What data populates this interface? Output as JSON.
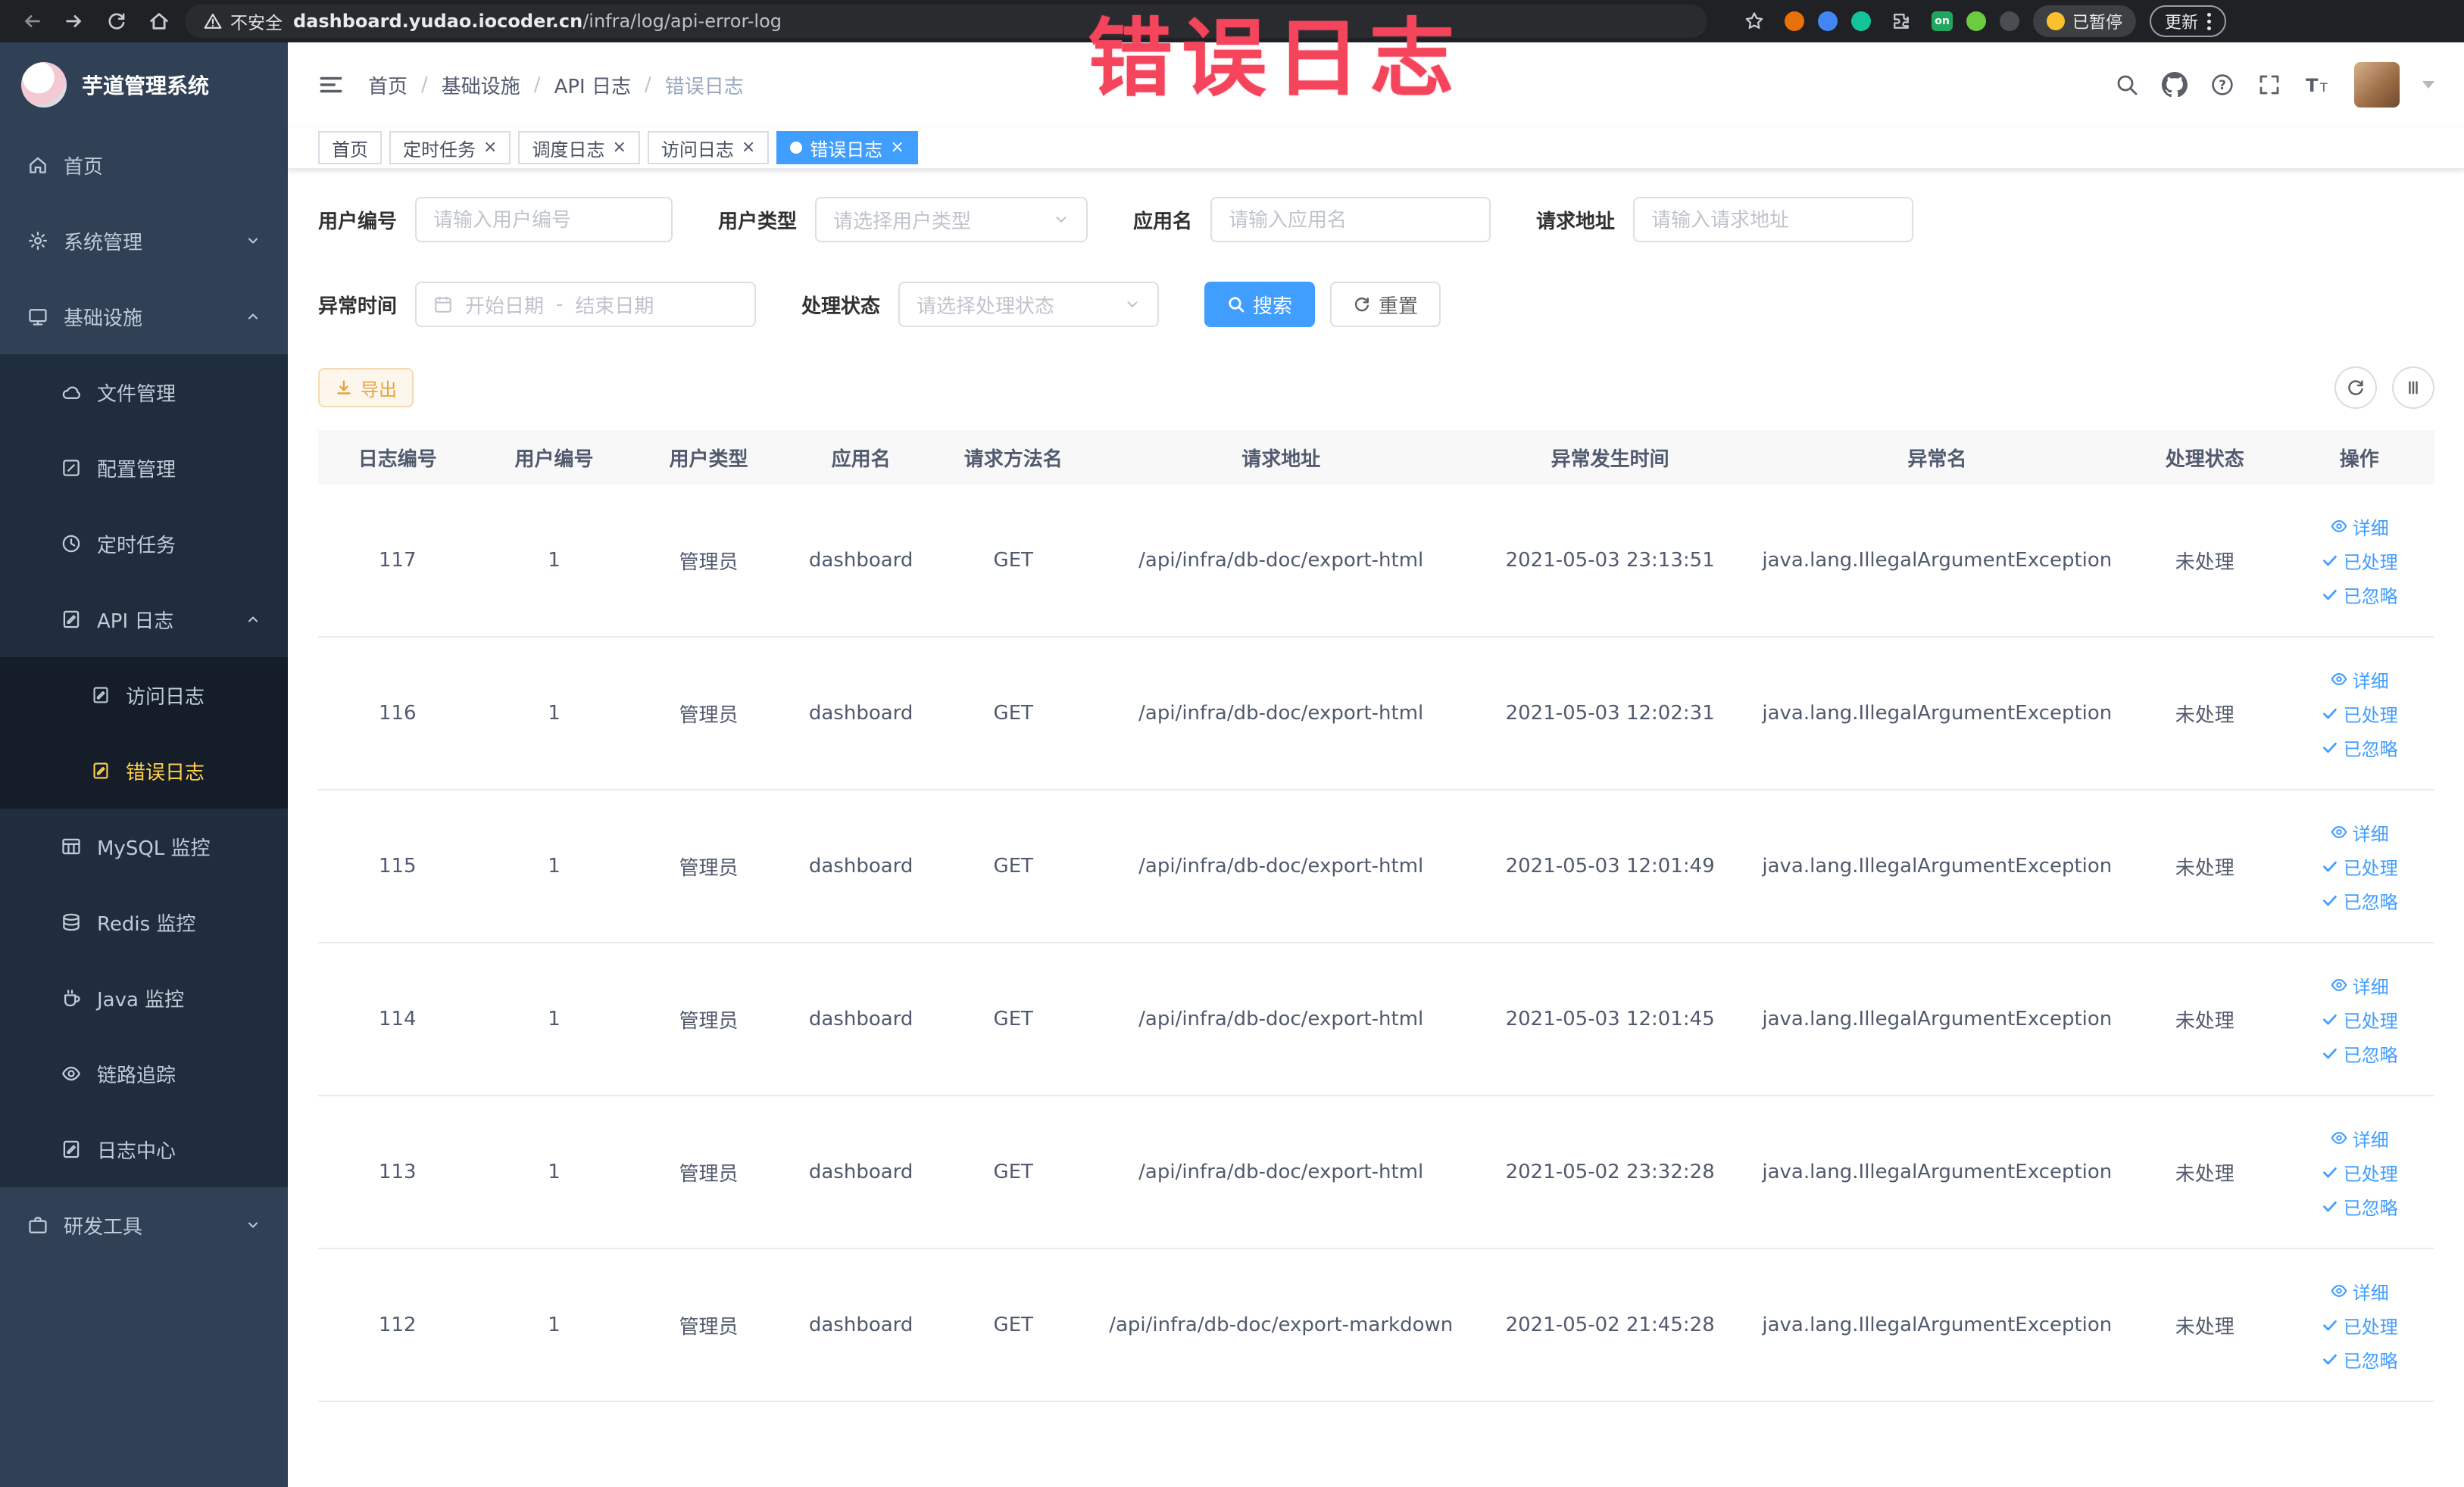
{
  "colors": {
    "accent": "#409eff",
    "warning": "#e6a23c",
    "annotation_red": "#f5455c",
    "sidebar_bg": "#304156",
    "active_menu": "#ffd04b"
  },
  "icons": {
    "close": "×"
  },
  "browser": {
    "security_label": "不安全",
    "url_host": "dashboard.yudao.iocoder.cn",
    "url_path": "/infra/log/api-error-log",
    "extension_badge": "on",
    "paused_badge": "已暂停",
    "update_button": "更新"
  },
  "annotation": {
    "text": "错误日志"
  },
  "sidebar": {
    "title": "芋道管理系统",
    "items": {
      "home": "首页",
      "system": "系统管理",
      "infra": "基础设施",
      "file": "文件管理",
      "config": "配置管理",
      "job": "定时任务",
      "api_log": "API 日志",
      "access_log": "访问日志",
      "error_log": "错误日志",
      "mysql": "MySQL 监控",
      "redis": "Redis 监控",
      "java": "Java 监控",
      "trace": "链路追踪",
      "log_center": "日志中心",
      "dev_tools": "研发工具"
    }
  },
  "header": {
    "breadcrumb": [
      "首页",
      "基础设施",
      "API 日志",
      "错误日志"
    ],
    "separator": "/"
  },
  "tabs": [
    {
      "label": "首页",
      "closable": false,
      "active": false
    },
    {
      "label": "定时任务",
      "closable": true,
      "active": false
    },
    {
      "label": "调度日志",
      "closable": true,
      "active": false
    },
    {
      "label": "访问日志",
      "closable": true,
      "active": false
    },
    {
      "label": "错误日志",
      "closable": true,
      "active": true
    }
  ],
  "filters": {
    "user_id": {
      "label": "用户编号",
      "placeholder": "请输入用户编号"
    },
    "user_type": {
      "label": "用户类型",
      "placeholder": "请选择用户类型"
    },
    "app_name": {
      "label": "应用名",
      "placeholder": "请输入应用名"
    },
    "request_url": {
      "label": "请求地址",
      "placeholder": "请输入请求地址"
    },
    "exception_time": {
      "label": "异常时间",
      "start_placeholder": "开始日期",
      "end_placeholder": "结束日期",
      "separator": "-"
    },
    "process_status": {
      "label": "处理状态",
      "placeholder": "请选择处理状态"
    },
    "search_button": "搜索",
    "reset_button": "重置"
  },
  "toolbar": {
    "export_button": "导出"
  },
  "table": {
    "columns": [
      "日志编号",
      "用户编号",
      "用户类型",
      "应用名",
      "请求方法名",
      "请求地址",
      "异常发生时间",
      "异常名",
      "处理状态",
      "操作"
    ],
    "actions": [
      "详细",
      "已处理",
      "已忽略"
    ],
    "rows": [
      {
        "id": "117",
        "user_id": "1",
        "user_type": "管理员",
        "app": "dashboard",
        "method": "GET",
        "url": "/api/infra/db-doc/export-html",
        "time": "2021-05-03 23:13:51",
        "exception": "java.lang.IllegalArgumentException",
        "status": "未处理"
      },
      {
        "id": "116",
        "user_id": "1",
        "user_type": "管理员",
        "app": "dashboard",
        "method": "GET",
        "url": "/api/infra/db-doc/export-html",
        "time": "2021-05-03 12:02:31",
        "exception": "java.lang.IllegalArgumentException",
        "status": "未处理"
      },
      {
        "id": "115",
        "user_id": "1",
        "user_type": "管理员",
        "app": "dashboard",
        "method": "GET",
        "url": "/api/infra/db-doc/export-html",
        "time": "2021-05-03 12:01:49",
        "exception": "java.lang.IllegalArgumentException",
        "status": "未处理"
      },
      {
        "id": "114",
        "user_id": "1",
        "user_type": "管理员",
        "app": "dashboard",
        "method": "GET",
        "url": "/api/infra/db-doc/export-html",
        "time": "2021-05-03 12:01:45",
        "exception": "java.lang.IllegalArgumentException",
        "status": "未处理"
      },
      {
        "id": "113",
        "user_id": "1",
        "user_type": "管理员",
        "app": "dashboard",
        "method": "GET",
        "url": "/api/infra/db-doc/export-html",
        "time": "2021-05-02 23:32:28",
        "exception": "java.lang.IllegalArgumentException",
        "status": "未处理"
      },
      {
        "id": "112",
        "user_id": "1",
        "user_type": "管理员",
        "app": "dashboard",
        "method": "GET",
        "url": "/api/infra/db-doc/export-markdown",
        "time": "2021-05-02 21:45:28",
        "exception": "java.lang.IllegalArgumentException",
        "status": "未处理"
      }
    ]
  }
}
